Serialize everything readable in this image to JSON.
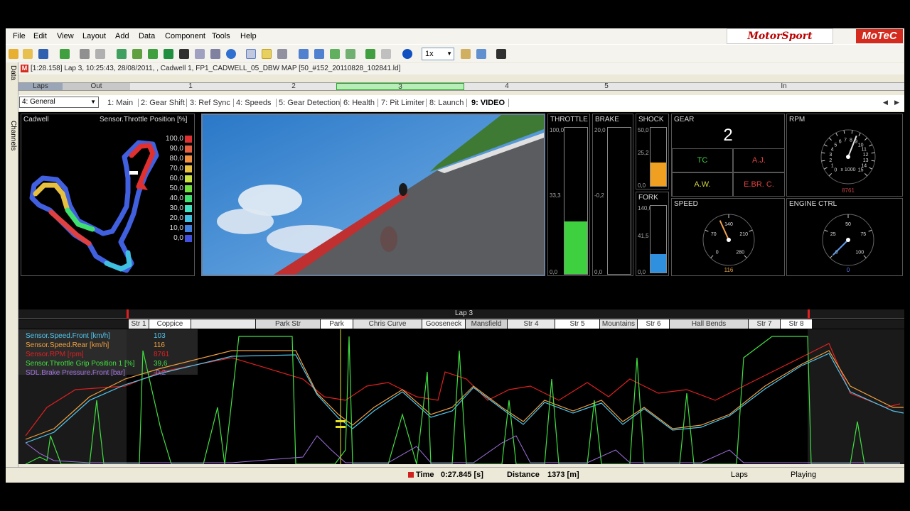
{
  "menu": [
    "File",
    "Edit",
    "View",
    "Layout",
    "Add",
    "Data",
    "Component",
    "Tools",
    "Help"
  ],
  "logos": {
    "motorsport": "MotorSport",
    "motec": "MoTeC"
  },
  "toolbar": {
    "zoom": "1x"
  },
  "side_tabs": {
    "data": "Data",
    "channels": "Channels"
  },
  "file": {
    "badge": "M",
    "text": "[1:28.158] Lap 3, 10:25:43, 28/08/2011, , Cadwell 1, FP1_CADWELL_05_DBW MAP [50_#152_20110828_102841.ld]"
  },
  "laps_bar": {
    "label": "Laps",
    "segments": [
      "Out",
      "1",
      "2",
      "3",
      "4",
      "5",
      "In"
    ]
  },
  "worksheet": {
    "selected": "4: General",
    "tabs": [
      "1: Main",
      "2: Gear Shift",
      "3: Ref Sync",
      "4: Speeds",
      "5: Gear Detection",
      "6: Health",
      "7: Pit Limiter",
      "8: Launch",
      "9: VIDEO"
    ],
    "active_tab": "9: VIDEO"
  },
  "track_map": {
    "title": "Cadwell",
    "channel": "Sensor.Throttle Position [%]",
    "scale": [
      {
        "v": "100,0",
        "c": "#e03030"
      },
      {
        "v": "90,0",
        "c": "#e86040"
      },
      {
        "v": "80,0",
        "c": "#f09040"
      },
      {
        "v": "70,0",
        "c": "#e8c040"
      },
      {
        "v": "60,0",
        "c": "#c8e040"
      },
      {
        "v": "50,0",
        "c": "#70e040"
      },
      {
        "v": "40,0",
        "c": "#40e070"
      },
      {
        "v": "30,0",
        "c": "#40e0c0"
      },
      {
        "v": "20,0",
        "c": "#40c0e0"
      },
      {
        "v": "10,0",
        "c": "#4080e0"
      },
      {
        "v": "0,0",
        "c": "#4050e0"
      }
    ]
  },
  "throttle": {
    "title": "THROTTLE",
    "max": "100,0",
    "mid": "33,3",
    "min": "0,0",
    "level": 0.36,
    "color": "#3ed03e"
  },
  "brake": {
    "title": "BRAKE",
    "max": "20,0",
    "mid": "-0,2",
    "min": "0,0",
    "level": 0.0,
    "color": "#3ed03e"
  },
  "shock": {
    "title": "SHOCK",
    "max": "50,0",
    "mid": "25,2",
    "min": "0,0",
    "level": 0.4,
    "color": "#f0a020"
  },
  "fork": {
    "title": "FORK",
    "max": "140,0",
    "mid": "41,5",
    "min": "0,0",
    "level": 0.28,
    "color": "#3090e0"
  },
  "gear": {
    "title": "GEAR",
    "value": "2",
    "cells": [
      {
        "label": "TC",
        "color": "#40d040"
      },
      {
        "label": "A.J.",
        "color": "#e04040"
      },
      {
        "label": "A.W.",
        "color": "#d0d040"
      },
      {
        "label": "E.BR. C.",
        "color": "#e04040"
      }
    ]
  },
  "rpm": {
    "title": "RPM",
    "ticks": [
      "0",
      "1",
      "2",
      "3",
      "4",
      "5",
      "6",
      "7",
      "8",
      "9",
      "10",
      "11",
      "12",
      "13",
      "14",
      "15"
    ],
    "unit": "x 1000",
    "value": "8761",
    "level": 0.58
  },
  "speed": {
    "title": "SPEED",
    "ticks": [
      "0",
      "70",
      "140",
      "210",
      "280"
    ],
    "value": "116",
    "level": 0.41
  },
  "engine": {
    "title": "ENGINE CTRL",
    "ticks": [
      "0",
      "25",
      "50",
      "75",
      "100"
    ],
    "value": "0",
    "level": 0.0
  },
  "plot": {
    "lap_label": "Lap 3",
    "sectors": [
      "Str 1",
      "Coppice",
      "",
      "Park Str",
      "Park",
      "Chris Curve",
      "Gooseneck",
      "Mansfield",
      "Str 4",
      "Str 5",
      "Mountains",
      "Str 6",
      "Hall Bends",
      "Str 7",
      "Str 8"
    ],
    "channels": [
      {
        "name": "Sensor.Speed.Front [km/h]",
        "value": "103",
        "color": "#50c8f0"
      },
      {
        "name": "Sensor.Speed.Rear [km/h]",
        "value": "116",
        "color": "#f0a040"
      },
      {
        "name": "Sensor.RPM [rpm]",
        "value": "8761",
        "color": "#e02020"
      },
      {
        "name": "Sensor.Throttle Grip Position 1 [%]",
        "value": "39,6",
        "color": "#40e040"
      },
      {
        "name": "SDL.Brake Pressure.Front [bar]",
        "value": "-0,2",
        "color": "#a070e0"
      }
    ]
  },
  "status": {
    "time_label": "Time",
    "time_value": "0:27.845 [s]",
    "distance_label": "Distance",
    "distance_value": "1373 [m]",
    "laps": "Laps",
    "state": "Playing"
  }
}
